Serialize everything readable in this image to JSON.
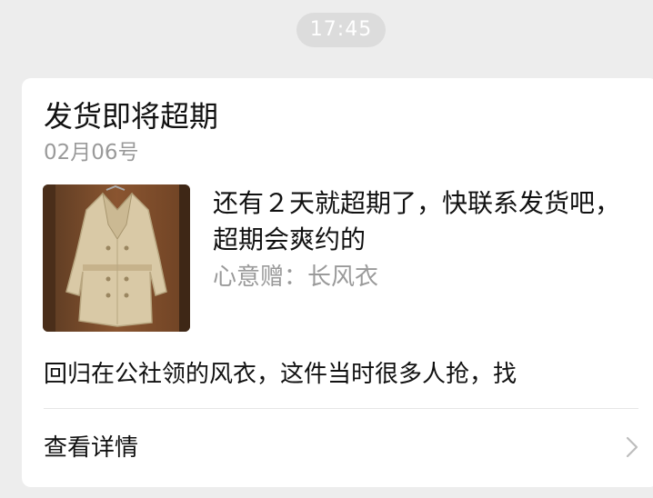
{
  "timestamp": "17:45",
  "card": {
    "title": "发货即将超期",
    "date": "02月06号",
    "notice": "还有２天就超期了，快联系发货吧，超期会爽约的",
    "gift": "心意赠：长风衣",
    "description": "回归在公社领的风衣，这件当时很多人抢，找",
    "details_label": "查看详情",
    "thumbnail_icon": "trench-coat-photo",
    "chevron_icon": "chevron-right-icon"
  }
}
